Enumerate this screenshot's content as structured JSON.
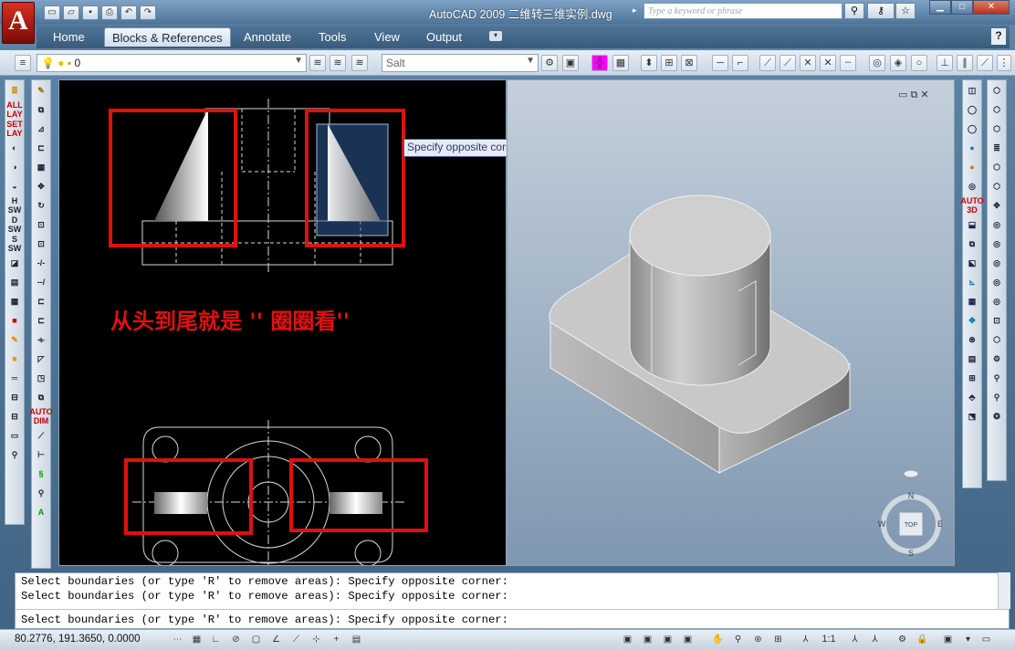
{
  "window": {
    "title": "AutoCAD 2009  二维转三维实例.dwg",
    "search_placeholder": "Type a keyword or phrase",
    "logo_letter": "A"
  },
  "ribbon": {
    "tabs": [
      "Home",
      "Blocks & References",
      "Annotate",
      "Tools",
      "View",
      "Output"
    ],
    "active_tab": "Blocks & References",
    "help": "?"
  },
  "toolbar": {
    "layer_value": "0",
    "style_value": "Salt"
  },
  "left_tools_a": [
    "layer-icon",
    "ALL LAY",
    "SET LAY",
    "layer-prev-icon",
    "layer-isolate-icon",
    "layer-freeze-icon",
    "H SW",
    "D SW",
    "S SW",
    "erase-dim-icon",
    "qselect-icon",
    "table-icon",
    "palette-icon",
    "paint-icon",
    "color-icon",
    "line-type-icon",
    "stretch-icon",
    "lengthen-icon",
    "print-icon",
    "zoom-icon"
  ],
  "left_tools_b": [
    "pencil-icon",
    "copy-icon",
    "mirror-icon",
    "offset-icon",
    "array-icon",
    "move-icon",
    "rotate-icon",
    "scale-icon",
    "stretch-icon",
    "trim-icon",
    "extend-icon",
    "break-icon",
    "join-icon",
    "chamfer-icon",
    "fillet-icon",
    "explode-icon",
    "AUTO DIM",
    "dim-linear-icon",
    "dim-aligned-icon",
    "pan-icon",
    "zoom-icon",
    "text-icon"
  ],
  "drawing": {
    "caption": "从头到尾就是 '' 圈圈看''",
    "tooltip": "Specify opposite corner:"
  },
  "viewcube": {
    "face": "TOP",
    "north": "N",
    "south": "S",
    "east": "E",
    "west": "W"
  },
  "command": {
    "lines": [
      "Select boundaries (or type 'R' to remove areas): Specify opposite corner:",
      "Select boundaries (or type 'R' to remove areas): Specify opposite corner:",
      "Select boundaries (or type 'R' to remove areas): Specify opposite corner:"
    ]
  },
  "status": {
    "coords": "80.2776, 191.3650, 0.0000",
    "scale": "1:1"
  },
  "right_tools_a": [
    "box-icon",
    "sphere-icon",
    "cylinder-icon",
    "cone-icon",
    "ball-icon",
    "shade-icon",
    "camera-icon",
    "AUTO 3D",
    "solid-icon",
    "union-icon",
    "subtract-icon",
    "ucs-icon",
    "grid-icon",
    "orbit-icon",
    "view-icon",
    "section-icon",
    "render-icon",
    "light-icon",
    "material-icon",
    "print-icon"
  ],
  "right_tools_b": [
    "extrude-icon",
    "revolve-icon",
    "sweep-icon",
    "loft-icon",
    "presspull-icon",
    "slice-icon",
    "interfere-icon",
    "section-plane-icon",
    "flatten-icon",
    "thicken-icon",
    "imprint-icon",
    "ring-icon",
    "ring2-icon",
    "ring3-icon",
    "ring4-icon",
    "box3d-icon",
    "orbit-icon",
    "zoom-icon",
    "pan-icon",
    "walk-icon"
  ],
  "colors": {
    "red": "#e01010",
    "cad_line": "#d8d8d8"
  }
}
